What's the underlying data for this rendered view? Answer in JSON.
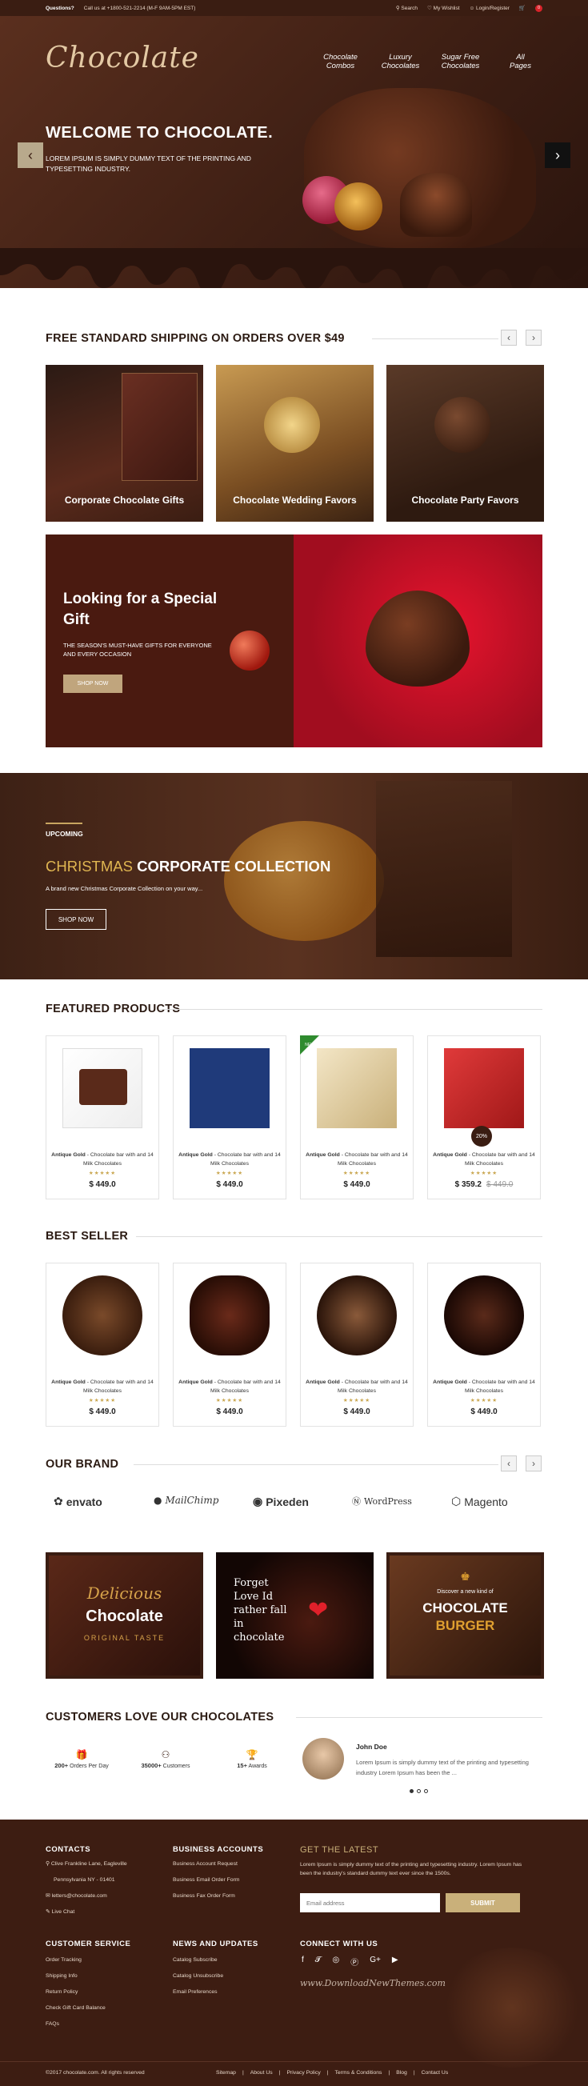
{
  "topbar": {
    "questions": "Questions?",
    "call": "Call us at +1800-521-2214 (M-F 9AM-5PM EST)",
    "search": "Search",
    "wishlist": "My Wishlist",
    "login": "Login/Register",
    "cart_count": "0"
  },
  "hero": {
    "logo": "Chocolate",
    "nav": [
      {
        "l1": "Chocolate",
        "l2": "Combos"
      },
      {
        "l1": "Luxury",
        "l2": "Chocolates"
      },
      {
        "l1": "Sugar Free",
        "l2": "Chocolates"
      },
      {
        "l1": "All",
        "l2": "Pages"
      }
    ],
    "title": "WELCOME TO CHOCOLATE.",
    "text": "LOREM IPSUM IS SIMPLY DUMMY TEXT OF THE PRINTING AND TYPESETTING INDUSTRY."
  },
  "shipping": {
    "title": "FREE STANDARD SHIPPING ON ORDERS OVER $49",
    "cards": [
      "Corporate Chocolate Gifts",
      "Chocolate Wedding Favors",
      "Chocolate Party Favors"
    ]
  },
  "gift": {
    "title": "Looking for a Special Gift",
    "text": "THE SEASON'S MUST-HAVE GIFTS FOR EVERYONE AND EVERY OCCASION",
    "button": "SHOP NOW"
  },
  "xmas": {
    "upcoming": "UPCOMING",
    "title_a": "CHRISTMAS",
    "title_b": "CORPORATE COLLECTION",
    "text": "A brand new Christmas Corporate Collection on your way...",
    "button": "SHOP NOW"
  },
  "featured": {
    "title": "FEATURED PRODUCTS",
    "products": [
      {
        "brand": "Antique Gold",
        "name": " - Chocolate bar with and 14 Milk Chocolates",
        "price": "$ 449.0",
        "old": ""
      },
      {
        "brand": "Antique Gold",
        "name": " - Chocolate bar with and 14 Milk Chocolates",
        "price": "$ 449.0",
        "old": ""
      },
      {
        "brand": "Antique Gold",
        "name": " - Chocolate bar with and 14 Milk Chocolates",
        "price": "$ 449.0",
        "old": ""
      },
      {
        "brand": "Antique Gold",
        "name": " - Chocolate bar with and 14 Milk Chocolates",
        "price": "$ 359.2",
        "old": "$ 449.0"
      }
    ],
    "new_tag": "NEW",
    "sale_tag": "20%"
  },
  "bestseller": {
    "title": "BEST SELLER",
    "products": [
      {
        "brand": "Antique Gold",
        "name": " - Chocolate bar with and 14 Milk Chocolates",
        "price": "$ 449.0"
      },
      {
        "brand": "Antique Gold",
        "name": " - Chocolate bar with and 14 Milk Chocolates",
        "price": "$ 449.0"
      },
      {
        "brand": "Antique Gold",
        "name": " - Chocolate bar with and 14 Milk Chocolates",
        "price": "$ 449.0"
      },
      {
        "brand": "Antique Gold",
        "name": " - Chocolate bar with and 14 Milk Chocolates",
        "price": "$ 449.0"
      }
    ]
  },
  "brands": {
    "title": "OUR BRAND",
    "items": [
      "envato",
      "MailChimp",
      "Pixeden",
      "WordPress",
      "Magento"
    ]
  },
  "banners": {
    "b1_a": "Delicious",
    "b1_b": "Chocolate",
    "b1_c": "ORIGINAL TASTE",
    "b2": "Forget Love Id rather fall in chocolate",
    "b3_a": "Discover a new kind of",
    "b3_b": "CHOCOLATE",
    "b3_c": "BURGER"
  },
  "customers": {
    "title": "CUSTOMERS LOVE OUR CHOCOLATES",
    "stats": [
      {
        "num": "200+",
        "label": "Orders Per Day"
      },
      {
        "num": "35000+",
        "label": "Customers"
      },
      {
        "num": "15+",
        "label": "Awards"
      }
    ],
    "testimonial_name": "John Doe",
    "testimonial_text": "Lorem Ipsum is simply dummy text of the printing and typesetting industry Lorem Ipsum has been the ..."
  },
  "footer": {
    "contacts_title": "CONTACTS",
    "address1": "Clive Frankline Lane, Eagleville",
    "address2": "Pennsylvania NY - 01401",
    "email": "letters@chocolate.com",
    "chat": "Live Chat",
    "business_title": "BUSINESS ACCOUNTS",
    "business": [
      "Business Account Request",
      "Business Email Order Form",
      "Business Fax Order Form"
    ],
    "latest_title": "GET THE LATEST",
    "latest_text": "Lorem Ipsum is simply dummy text of the printing and typesetting industry. Lorem Ipsum has been the industry's standard dummy text ever since the 1500s.",
    "email_placeholder": "Email address",
    "submit": "SUBMIT",
    "service_title": "CUSTOMER SERVICE",
    "service": [
      "Order Tracking",
      "Shipping Info",
      "Return Policy",
      "Check Gift Card Balance",
      "FAQs"
    ],
    "news_title": "NEWS AND UPDATES",
    "news": [
      "Catalog Subscribe",
      "Catalog Unsubscribe",
      "Email Preferences"
    ],
    "connect_title": "CONNECT WITH US",
    "watermark": "www.DownloadNewThemes.com",
    "copyright": "©2017 chocolate.com. All rights reserved",
    "links": [
      "Sitemap",
      "About Us",
      "Privacy Policy",
      "Terms & Conditions",
      "Blog",
      "Contact Us"
    ]
  }
}
